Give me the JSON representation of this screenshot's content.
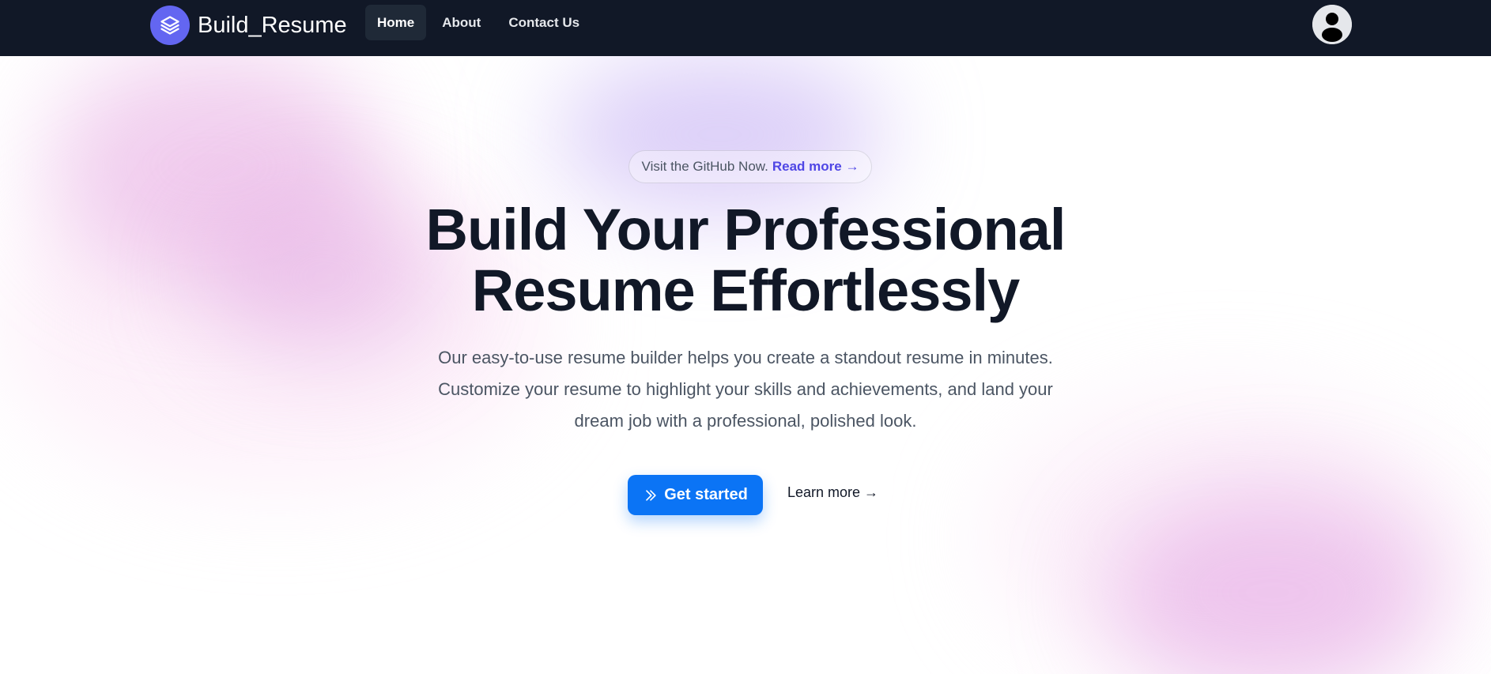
{
  "app": {
    "brand_name": "Build_Resume",
    "brand_color": "#6366f1",
    "logo_icon": "layers-icon"
  },
  "nav": {
    "items": [
      {
        "label": "Home",
        "active": true
      },
      {
        "label": "About",
        "active": false
      },
      {
        "label": "Contact Us",
        "active": false
      }
    ],
    "avatar_icon": "user-avatar-icon",
    "background": "#111827"
  },
  "hero": {
    "announcement_text": "Visit the GitHub Now.",
    "announcement_link": "Read more →",
    "headline_line1": "Build Your Professional",
    "headline_line2": "Resume Effortlessly",
    "description": "Our easy-to-use resume builder helps you create a standout resume in minutes. Customize your resume to highlight your skills and achievements, and land your dream job with a professional, polished look.",
    "primary_cta": "Get started",
    "primary_cta_icon": "chevrons-right-icon",
    "primary_cta_color": "#0b74f5",
    "secondary_cta": "Learn more →"
  }
}
